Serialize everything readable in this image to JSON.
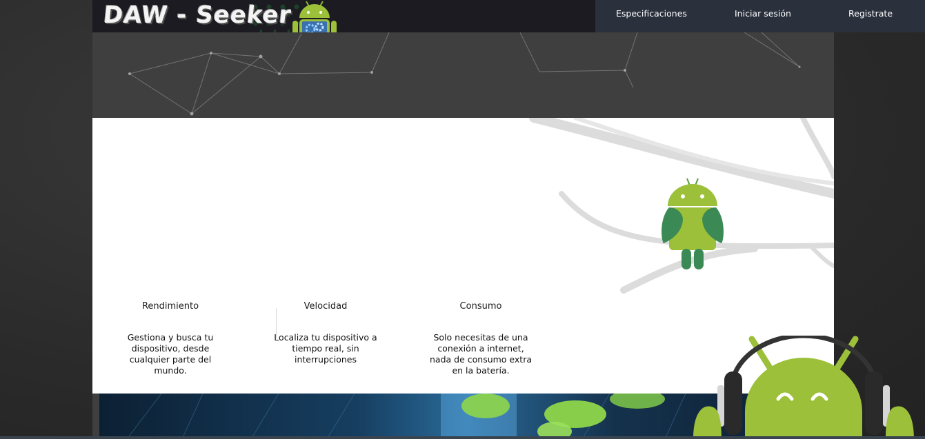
{
  "header": {
    "logo_text": "DAW - Seeker"
  },
  "nav": {
    "items": [
      {
        "label": "Especificaciones"
      },
      {
        "label": "Iniciar sesión"
      },
      {
        "label": "Registrate"
      }
    ]
  },
  "features": [
    {
      "title": "Rendimiento",
      "description": "Gestiona y busca tu dispositivo, desde cualquier parte del mundo."
    },
    {
      "title": "Velocidad",
      "description": "Localiza tu dispositivo a tiempo real, sin interrupciones"
    },
    {
      "title": "Consumo",
      "description": "Solo necesitas de una conexión a internet, nada de consumo extra en la batería."
    }
  ],
  "colors": {
    "android_green": "#9cc03a",
    "wing_green": "#3b8a55",
    "nav_bg": "#2a303c",
    "header_bg": "#1c1b22",
    "hero_bg": "#3f3f3f"
  },
  "icons": {
    "logo_android": "android-gears-icon",
    "bird_android": "android-bird-icon",
    "headphones_android": "android-headphones-icon"
  }
}
